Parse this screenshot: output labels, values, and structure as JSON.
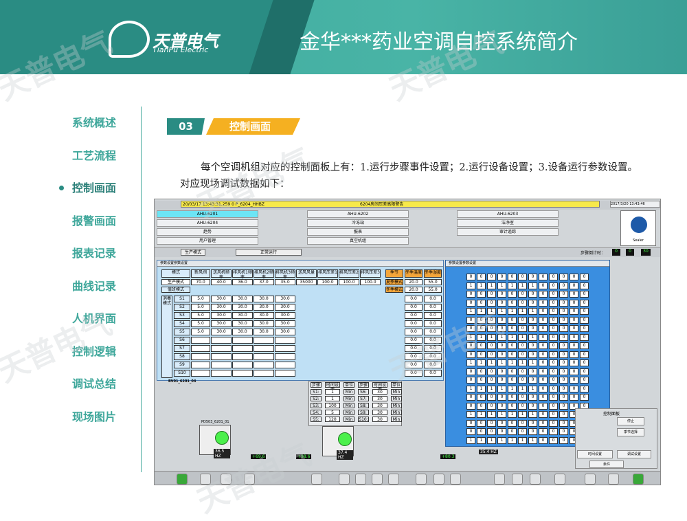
{
  "header": {
    "logo_text": "天普电气",
    "logo_sub": "TianPu Electric",
    "title": "金华***药业空调自控系统简介"
  },
  "nav": [
    {
      "label": "系统概述",
      "active": false
    },
    {
      "label": "工艺流程",
      "active": false
    },
    {
      "label": "控制画面",
      "active": true
    },
    {
      "label": "报警画面",
      "active": false
    },
    {
      "label": "报表记录",
      "active": false
    },
    {
      "label": "曲线记录",
      "active": false
    },
    {
      "label": "人机界面",
      "active": false
    },
    {
      "label": "控制逻辑",
      "active": false
    },
    {
      "label": "调试总结",
      "active": false
    },
    {
      "label": "现场图片",
      "active": false
    }
  ],
  "section": {
    "num": "03",
    "title": "控制画面"
  },
  "paragraph": "每个空调机组对应的控制面板上有：1.运行步骤事件设置；2.运行设备设置；3.设备运行参数设置。对应现场调试数据如下：",
  "screen": {
    "alarm_left": "20/03/17 13:43:31.259 0  P_6204_HHBZ",
    "alarm_msg": "6204房间压差高限警告",
    "clock": "2017/3/20 13:43:46",
    "units": [
      [
        "AHU-6201",
        "AHU-6202",
        "AHU-6203"
      ],
      [
        "AHU-6204",
        "冷冻站",
        "洁净室"
      ],
      [
        "趋势",
        "报表",
        "审计追踪"
      ],
      [
        "用户管理",
        "真空机组",
        ""
      ]
    ],
    "mode_label": "生产模式",
    "run_status": "正常运行",
    "countdown_label": "步骤倒计时：",
    "cd_h": "0",
    "cd_m": "0",
    "cd_s": "30",
    "logo_label": "Sealer",
    "panel1_title": "参数设置参数设置",
    "panel1_cols": [
      "模式",
      "新风阀",
      "送风机频率",
      "排风机1频率",
      "排风机2频率",
      "排风机3频率",
      "送风风量",
      "排风压差1",
      "排风压差2",
      "排风压差3"
    ],
    "prod_row": [
      "生产模式",
      "70.0",
      "40.0",
      "36.0",
      "37.0",
      "35.0",
      "35000",
      "100.0",
      "100.0",
      "100.0"
    ],
    "cycle_label": "值班模式",
    "clean_label": "消毒模式",
    "s_rows": [
      "S1",
      "S2",
      "S3",
      "S4",
      "S5",
      "S6",
      "S7",
      "S8",
      "S9",
      "S10"
    ],
    "s_vals": [
      [
        "5.0",
        "30.0",
        "30.0",
        "30.0",
        "30.0"
      ],
      [
        "5.0",
        "30.0",
        "30.0",
        "30.0",
        "30.0"
      ],
      [
        "5.0",
        "30.0",
        "30.0",
        "30.0",
        "30.0"
      ],
      [
        "5.0",
        "30.0",
        "30.0",
        "30.0",
        "30.0"
      ],
      [
        "5.0",
        "30.0",
        "30.0",
        "30.0",
        "30.0"
      ],
      [
        "",
        "",
        "",
        "",
        ""
      ],
      [
        "",
        "",
        "",
        "",
        ""
      ],
      [
        "",
        "",
        "",
        "",
        ""
      ],
      [
        "",
        "",
        "",
        "",
        ""
      ],
      [
        "",
        "",
        "",
        "",
        ""
      ]
    ],
    "right_hdr": [
      "季节",
      "冬季温度",
      "冬季湿度"
    ],
    "right_rows": [
      [
        "夏季模式",
        "20.0",
        "55.0"
      ],
      [
        "冬季模式",
        "20.0",
        "55.0"
      ]
    ],
    "right_zeros": [
      "0.0",
      "0.0"
    ],
    "panel2_title": "参数设置参数设置",
    "step_label": "步骤",
    "step_rows": [
      [
        "S1:",
        "1",
        "Min",
        "S6:",
        "30",
        "Min"
      ],
      [
        "S2:",
        "1",
        "Min",
        "S7:",
        "30",
        "Min"
      ],
      [
        "S3:",
        "100",
        "Min",
        "S8:",
        "30",
        "Min"
      ],
      [
        "S4:",
        "5",
        "Min",
        "S9:",
        "30",
        "Min"
      ],
      [
        "S5:",
        "120",
        "Min",
        "S10:",
        "30",
        "Min"
      ]
    ],
    "step_hdr": [
      "步骤",
      "时间设置",
      "单位",
      "步骤",
      "时间设置",
      "单位"
    ],
    "hz_values": [
      "36.5 HZ",
      "37.4 HZ",
      "35.4 HZ"
    ],
    "pd_label": "PD503_6201_01",
    "readings": [
      "+69.6",
      "+98.6",
      "+80.3"
    ],
    "right_panel_title": "控制面板",
    "right_btns": [
      "停止",
      "季节选择",
      "时间设置",
      "调试设置",
      "条件"
    ],
    "bv_label": "BV01_6201_04"
  }
}
